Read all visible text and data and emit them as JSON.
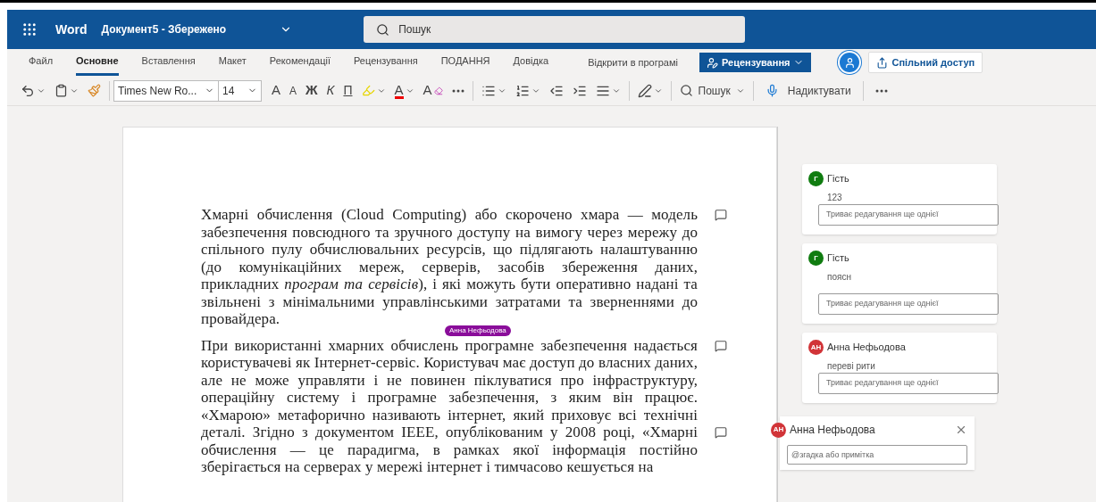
{
  "title_bar": {
    "app": "Word",
    "document": "Документ5 - Збережено",
    "search_placeholder": "Пошук"
  },
  "menu_tabs": [
    {
      "label": "Файл",
      "selected": false
    },
    {
      "label": "Основне",
      "selected": true
    },
    {
      "label": "Вставлення",
      "selected": false
    },
    {
      "label": "Макет",
      "selected": false
    },
    {
      "label": "Рекомендації",
      "selected": false
    },
    {
      "label": "Рецензування",
      "selected": false
    },
    {
      "label": "ПОДАННЯ",
      "selected": false
    },
    {
      "label": "Довідка",
      "selected": false
    }
  ],
  "open_in_app": "Відкрити в програмі",
  "mode_button": "Рецензування",
  "share_button": "Спільний доступ",
  "toolbar": {
    "font": "Times New Ro...",
    "size": "14",
    "grow_font": "A",
    "shrink_font": "A",
    "bold": "Ж",
    "italic": "К",
    "underline": "П",
    "font_color": "A",
    "clear_format": "A",
    "search": "Пошук",
    "dictate": "Надиктувати"
  },
  "document": {
    "paragraphs": [
      "Хмарні обчислення (Cloud Computing) або скорочено хмара — модель забезпечення повсюдного та зручного доступу на вимогу через мережу до спільного пулу обчислювальних ресурсів, що підлягають налаштуванню (до комунікаційних мереж, серверів, засобів збереження даних, прикладних *програм та сервісів*), і які можуть бути оперативно надані та звільнені з мінімальними управлінськими затратами та зверненнями до провайдера.",
      "При використанні хмарних обчислень програмне забезпечення надається користувачеві як Інтернет-сервіс. Користувач має доступ до власних даних, але не може управляти і не повинен піклуватися про інфраструктуру, операційну систему і програмне забезпечення, з яким він працює. «Хмарою» метафорично називають інтернет, який приховує всі технічні деталі. Згідно з документом IEEE, опублікованим у 2008 році, «Хмарні обчислення — це парадигма, в рамках якої інформація постійно зберігається на серверах у мережі інтернет і тимчасово кешується на"
    ],
    "presence_label": "Анна Нефьодова"
  },
  "comments": [
    {
      "avatar": "Г",
      "color": "#107c10",
      "author": "Гість",
      "body": "123",
      "reply_placeholder": "Триває редагування ще однієї"
    },
    {
      "avatar": "Г",
      "color": "#107c10",
      "author": "Гість",
      "body": "поясн",
      "reply_placeholder": "Триває редагування ще однієї"
    },
    {
      "avatar": "АН",
      "color": "#d13438",
      "author": "Анна Нефьодова",
      "body": "переві рити",
      "reply_placeholder": "Триває редагування ще однієї"
    }
  ],
  "new_comment": {
    "avatar": "АН",
    "color": "#d13438",
    "author": "Анна Нефьодова",
    "placeholder": "@згадка або примітка"
  }
}
